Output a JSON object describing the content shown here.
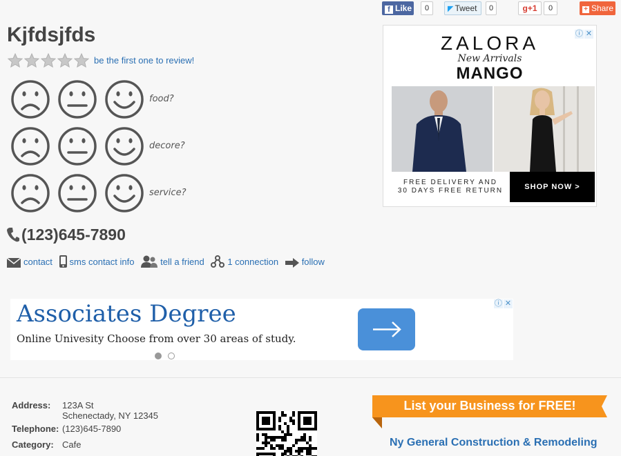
{
  "social": {
    "like_label": "Like",
    "like_count": "0",
    "tweet_label": "Tweet",
    "tweet_count": "0",
    "gplus_label": "g+1",
    "gplus_count": "0",
    "share_label": "Share"
  },
  "business": {
    "name": "Kjfdsjfds",
    "rating": 0,
    "rating_max": 5,
    "review_prompt": "be the first one to review!",
    "phone": "(123)645-7890"
  },
  "ratings_rows": [
    {
      "label": "food?"
    },
    {
      "label": "decore?"
    },
    {
      "label": "service?"
    }
  ],
  "actions": {
    "contact": "contact",
    "sms": "sms contact info",
    "tell_friend": "tell a friend",
    "connection": "1 connection",
    "follow": "follow"
  },
  "ad_zalora": {
    "brand": "ZALORA",
    "subtitle": "New Arrivals",
    "partner": "MANGO",
    "delivery_line1": "FREE DELIVERY AND",
    "delivery_line2": "30 DAYS FREE RETURN",
    "cta": "SHOP NOW >"
  },
  "ad_associates": {
    "title": "Associates Degree",
    "description": "Online Univesity Choose from over 30 areas of study.",
    "slides": 2,
    "active_slide": 1
  },
  "details": {
    "address_label": "Address:",
    "address_line1": "123A St",
    "address_line2": "Schenectady, NY 12345",
    "telephone_label": "Telephone:",
    "telephone": "(123)645-7890",
    "category_label": "Category:",
    "category": "Cafe"
  },
  "promo": {
    "ribbon": "List your Business for FREE!",
    "link": "Ny General Construction & Remodeling"
  },
  "colors": {
    "link": "#2a6fb3",
    "facebook": "#4c67a1",
    "share": "#f0653c",
    "ribbon": "#f7941d",
    "ad_title": "#1f5fa9"
  }
}
